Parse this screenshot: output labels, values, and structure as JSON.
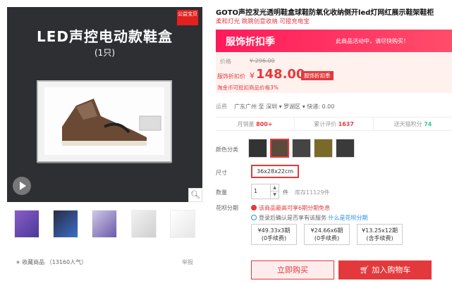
{
  "gallery": {
    "banner_title": "LED声控电动款鞋盒",
    "banner_sub": "(1只)",
    "official_badge": "公益宝贝",
    "zoom_icon": "magnifier-icon",
    "collect": "收藏商品 （13160人气）",
    "report": "举报"
  },
  "product": {
    "title": "GOTO声控发光透明鞋盒球鞋防氧化收纳侧开led灯网红展示鞋架鞋柜",
    "subtitle": "柔和灯光 跳跳创意收纳 可接充电宝"
  },
  "promo": {
    "title": "服饰折扣季",
    "note": "此商品活动中，请尽快购买！"
  },
  "price": {
    "orig_label": "价格",
    "orig_price": "¥ 296.00",
    "deal_label": "服饰折扣价",
    "currency": "¥",
    "deal_price": "148.00",
    "deal_badge": "服饰折扣季",
    "points": "淘金币可抵扣商品价格3%"
  },
  "shipping": {
    "label": "运费",
    "text": "广东广州 至 深圳 ▾ 罗湖区 ▾ 快递: 0.00"
  },
  "stats": [
    {
      "label": "月销量",
      "value": "800+"
    },
    {
      "label": "累计评价",
      "value": "1637"
    },
    {
      "label": "送天猫积分",
      "value": "74"
    }
  ],
  "options": {
    "color_label": "颜色分类",
    "size_label": "尺寸",
    "size_value": "36x28x22cm",
    "qty_label": "数量",
    "qty_value": "1",
    "unit": "件",
    "stock": "库存11129件"
  },
  "huabei": {
    "label": "花呗分期",
    "tip": "该商品最高可享6期分期免息",
    "login_pre": "登录后确认是否享有该服务 ",
    "login_link": "什么是花呗分期",
    "plans": [
      {
        "line1": "¥49.33x3期",
        "line2": "(0手续费)"
      },
      {
        "line1": "¥24.66x6期",
        "line2": "(0手续费)"
      },
      {
        "line1": "¥13.25x12期",
        "line2": "(含手续费)"
      }
    ]
  },
  "actions": {
    "buy_now": "立即购买",
    "add_cart": "加入购物车"
  }
}
